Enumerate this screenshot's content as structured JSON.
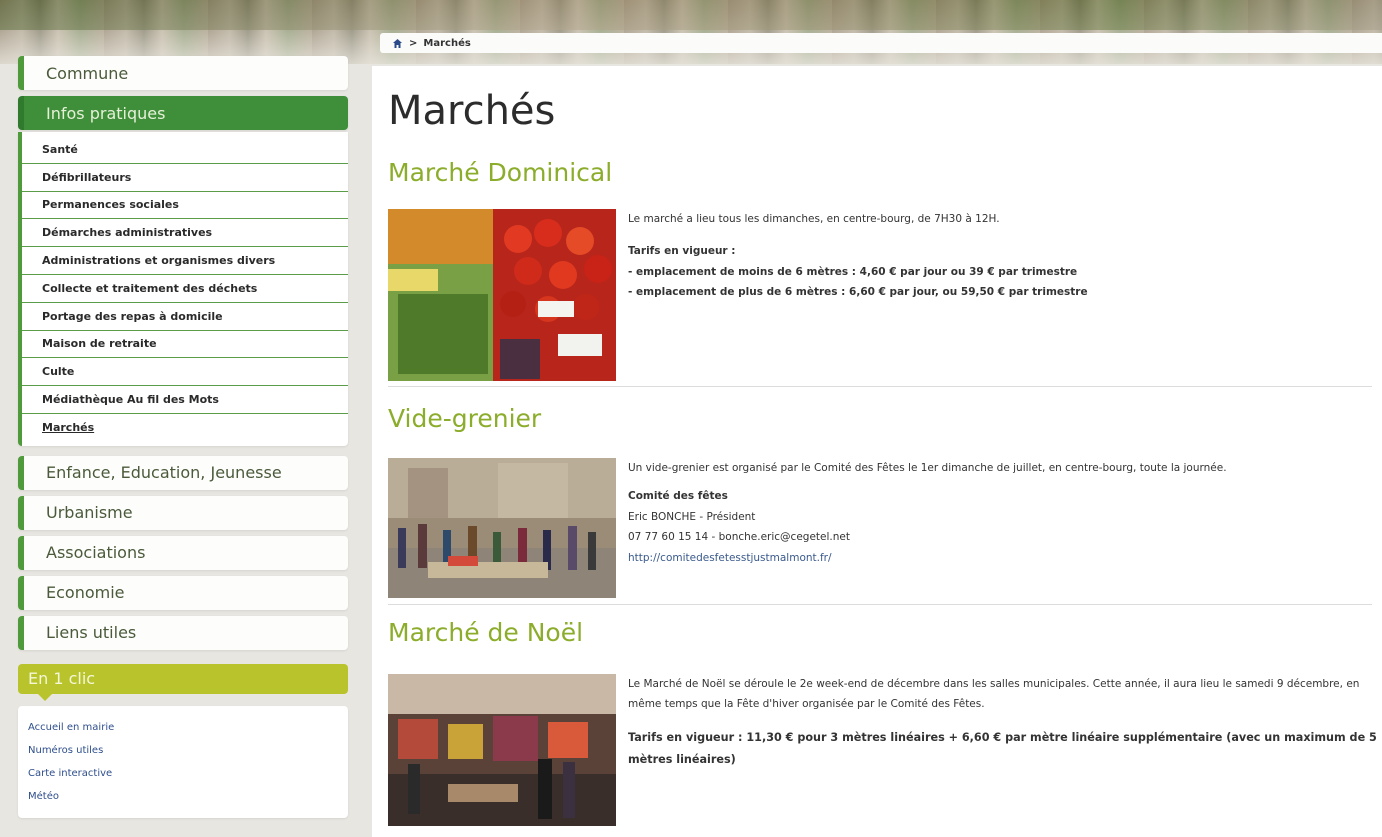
{
  "breadcrumb": {
    "current": "Marchés",
    "separator": ">"
  },
  "sidebar": {
    "sections": [
      {
        "label": "Commune"
      },
      {
        "label": "Infos pratiques"
      }
    ],
    "subnav": [
      "Santé",
      "Défibrillateurs",
      "Permanences sociales",
      "Démarches administratives",
      "Administrations et organismes divers",
      "Collecte et traitement des déchets",
      "Portage des repas à domicile",
      "Maison de retraite",
      "Culte",
      "Médiathèque Au fil des Mots",
      "Marchés"
    ],
    "more_sections": [
      "Enfance, Education, Jeunesse",
      "Urbanisme",
      "Associations",
      "Economie",
      "Liens utiles"
    ],
    "oneclic": {
      "title": "En 1 clic",
      "links": [
        "Accueil en mairie",
        "Numéros utiles",
        "Carte interactive",
        "Météo"
      ]
    }
  },
  "main": {
    "title": "Marchés",
    "sections": [
      {
        "heading": "Marché Dominical",
        "intro": "Le marché a lieu tous les dimanches, en centre-bourg, de 7H30 à 12H.",
        "tarifs_label": "Tarifs en vigueur :",
        "line1": "- emplacement de moins de 6 mètres : 4,60 € par jour ou 39 € par trimestre",
        "line2": "- emplacement de plus de 6 mètres : 6,60 € par jour, ou 59,50 € par trimestre"
      },
      {
        "heading": "Vide-grenier",
        "intro": "Un vide-grenier est organisé par le Comité des Fêtes le 1er dimanche de juillet, en centre-bourg, toute la journée.",
        "org": "Comité des fêtes",
        "president": "Eric BONCHE - Président",
        "contact": "07 77 60 15 14 - bonche.eric@cegetel.net",
        "url": "http://comitedesfetesstjustmalmont.fr/"
      },
      {
        "heading": "Marché de Noël",
        "intro": "Le Marché de Noël se déroule le 2e week-end de décembre dans les salles municipales. Cette année, il aura lieu le samedi 9 décembre, en même temps que la Fête d'hiver organisée par le Comité des Fêtes.",
        "tarifs": "Tarifs en vigueur : 11,30 € pour 3 mètres linéaires + 6,60 € par mètre linéaire supplémentaire (avec un maximum de 5 mètres linéaires)"
      }
    ]
  }
}
